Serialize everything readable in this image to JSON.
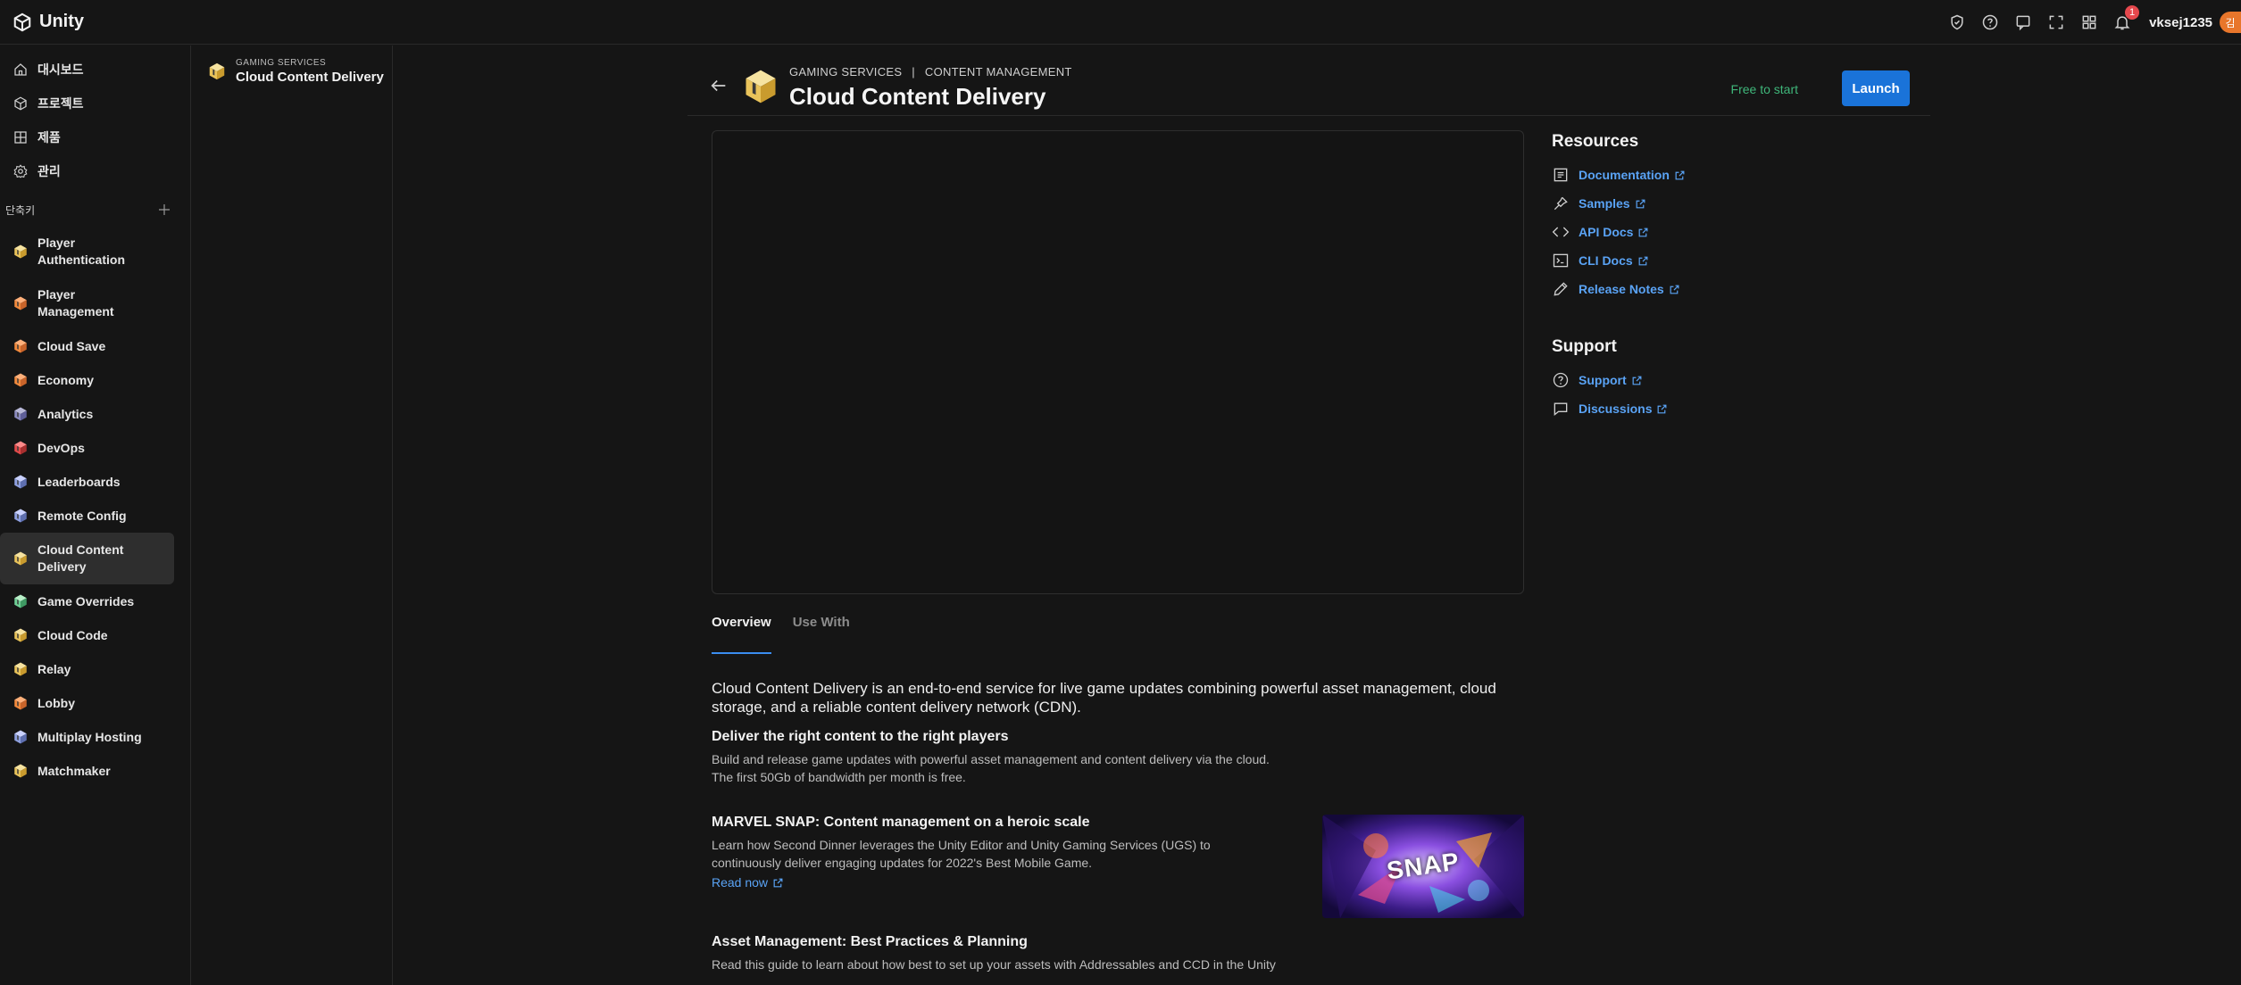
{
  "app": {
    "name": "Unity"
  },
  "topbar": {
    "username": "vksej1235",
    "avatar_initial": "김",
    "notification_count": "1",
    "icons": [
      "shield-check-icon",
      "help-icon",
      "chat-icon",
      "expand-icon",
      "apps-grid-icon",
      "bell-icon"
    ]
  },
  "nav": {
    "items": [
      {
        "label": "대시보드",
        "icon": "home-icon"
      },
      {
        "label": "프로젝트",
        "icon": "cube-icon"
      },
      {
        "label": "제품",
        "icon": "grid-icon"
      },
      {
        "label": "관리",
        "icon": "gear-icon"
      }
    ],
    "shortcuts_label": "단축키"
  },
  "shortcuts": [
    {
      "label": "Player Authentication"
    },
    {
      "label": "Player Management"
    },
    {
      "label": "Cloud Save"
    },
    {
      "label": "Economy"
    },
    {
      "label": "Analytics"
    },
    {
      "label": "DevOps"
    },
    {
      "label": "Leaderboards"
    },
    {
      "label": "Remote Config"
    },
    {
      "label": "Cloud Content Delivery"
    },
    {
      "label": "Game Overrides"
    },
    {
      "label": "Cloud Code"
    },
    {
      "label": "Relay"
    },
    {
      "label": "Lobby"
    },
    {
      "label": "Multiplay Hosting"
    },
    {
      "label": "Matchmaker"
    }
  ],
  "panel2": {
    "category": "GAMING SERVICES",
    "product": "Cloud Content Delivery"
  },
  "header": {
    "breadcrumb_1": "GAMING SERVICES",
    "breadcrumb_sep": "|",
    "breadcrumb_2": "CONTENT MANAGEMENT",
    "title": "Cloud Content Delivery",
    "free_label": "Free to start",
    "launch_label": "Launch"
  },
  "tabs": [
    {
      "label": "Overview",
      "active": true
    },
    {
      "label": "Use With",
      "active": false
    }
  ],
  "content": {
    "intro": "Cloud Content Delivery is an end-to-end service for live game updates combining powerful asset management, cloud storage, and a reliable content delivery network (CDN).",
    "sec1_title": "Deliver the right content to the right players",
    "sec1_line1": "Build and release game updates with powerful asset management and content delivery via the cloud.",
    "sec1_line2": "The first 50Gb of bandwidth per month is free.",
    "case_title": "MARVEL SNAP: Content management on a heroic scale",
    "case_body": "Learn how Second Dinner leverages the Unity Editor and Unity Gaming Services (UGS) to continuously deliver engaging updates for 2022's Best Mobile Game.",
    "case_link": "Read now",
    "case_image_text": "SNAP",
    "asset_title": "Asset Management: Best Practices & Planning",
    "asset_body": "Read this guide to learn about how best to set up your assets with Addressables and CCD in the Unity"
  },
  "resources": {
    "title": "Resources",
    "items": [
      {
        "label": "Documentation",
        "icon": "document-icon"
      },
      {
        "label": "Samples",
        "icon": "pin-icon"
      },
      {
        "label": "API Docs",
        "icon": "code-icon"
      },
      {
        "label": "CLI Docs",
        "icon": "terminal-icon"
      },
      {
        "label": "Release Notes",
        "icon": "pencil-icon"
      }
    ]
  },
  "support": {
    "title": "Support",
    "items": [
      {
        "label": "Support",
        "icon": "help-icon"
      },
      {
        "label": "Discussions",
        "icon": "chat-bubble-icon"
      }
    ]
  },
  "colors": {
    "accent": "#1a73d9",
    "link": "#5aa3f5",
    "free": "#3fb67a",
    "background": "#151515"
  }
}
